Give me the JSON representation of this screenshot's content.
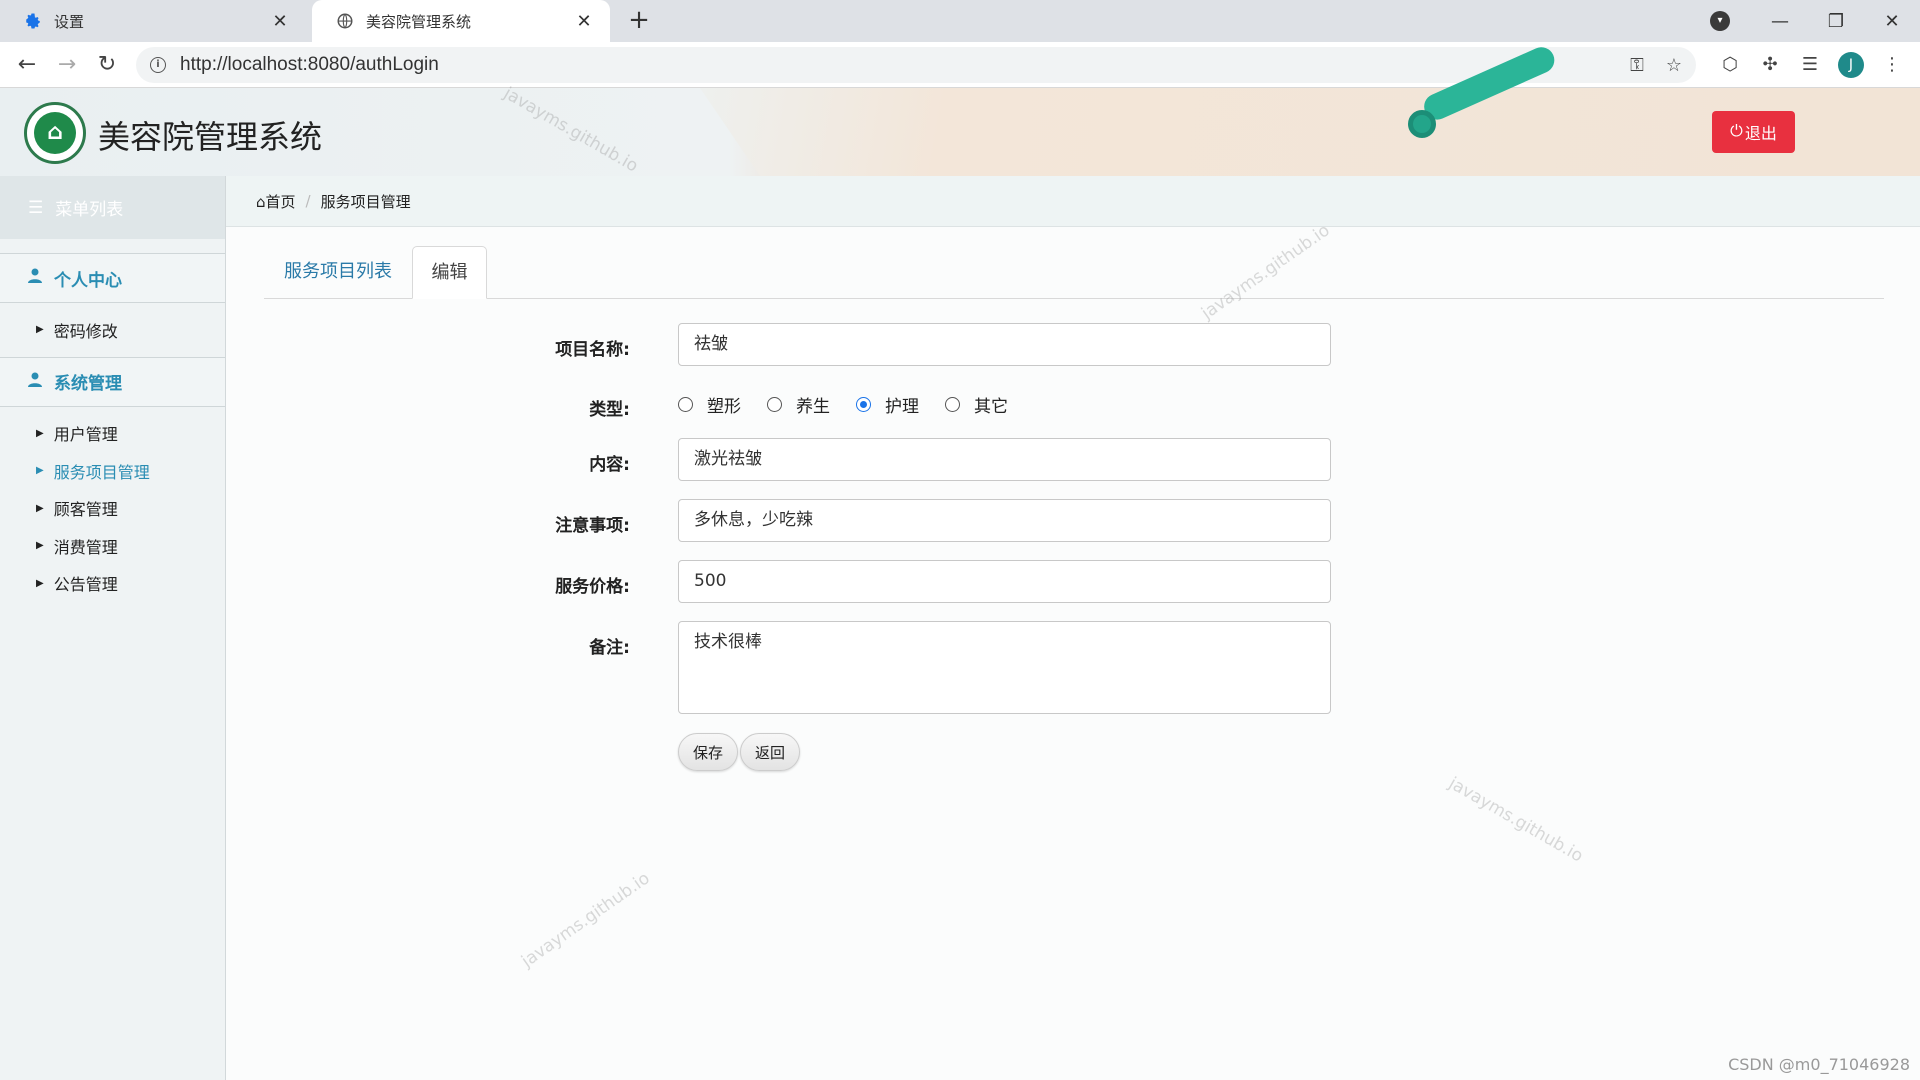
{
  "browser": {
    "tabs": [
      {
        "title": "设置",
        "icon": "gear-icon",
        "active": false
      },
      {
        "title": "美容院管理系统",
        "icon": "globe-icon",
        "active": true
      }
    ],
    "url": "http://localhost:8080/authLogin",
    "avatar_letter": "J"
  },
  "header": {
    "title": "美容院管理系统",
    "logout_label": "退出"
  },
  "sidebar": {
    "menu_title": "菜单列表",
    "groups": [
      {
        "label": "个人中心",
        "items": [
          {
            "label": "密码修改"
          }
        ]
      },
      {
        "label": "系统管理",
        "items": [
          {
            "label": "用户管理"
          },
          {
            "label": "服务项目管理",
            "active": true
          },
          {
            "label": "顾客管理"
          },
          {
            "label": "消费管理"
          },
          {
            "label": "公告管理"
          }
        ]
      }
    ]
  },
  "breadcrumb": {
    "home": "首页",
    "current": "服务项目管理"
  },
  "tabs": {
    "list": "服务项目列表",
    "edit": "编辑"
  },
  "form": {
    "name_label": "项目名称:",
    "name_value": "祛皱",
    "type_label": "类型:",
    "type_options": [
      "塑形",
      "养生",
      "护理",
      "其它"
    ],
    "type_selected": "护理",
    "content_label": "内容:",
    "content_value": "激光祛皱",
    "notes_label": "注意事项:",
    "notes_value": "多休息，少吃辣",
    "price_label": "服务价格:",
    "price_value": "500",
    "remark_label": "备注:",
    "remark_value": "技术很棒",
    "save_label": "保存",
    "back_label": "返回"
  },
  "watermark": "javayms.github.io",
  "footer_credit": "CSDN @m0_71046928",
  "colors": {
    "accent": "#2a8db3",
    "logout": "#e8303f",
    "radio_checked": "#1a73e8"
  }
}
